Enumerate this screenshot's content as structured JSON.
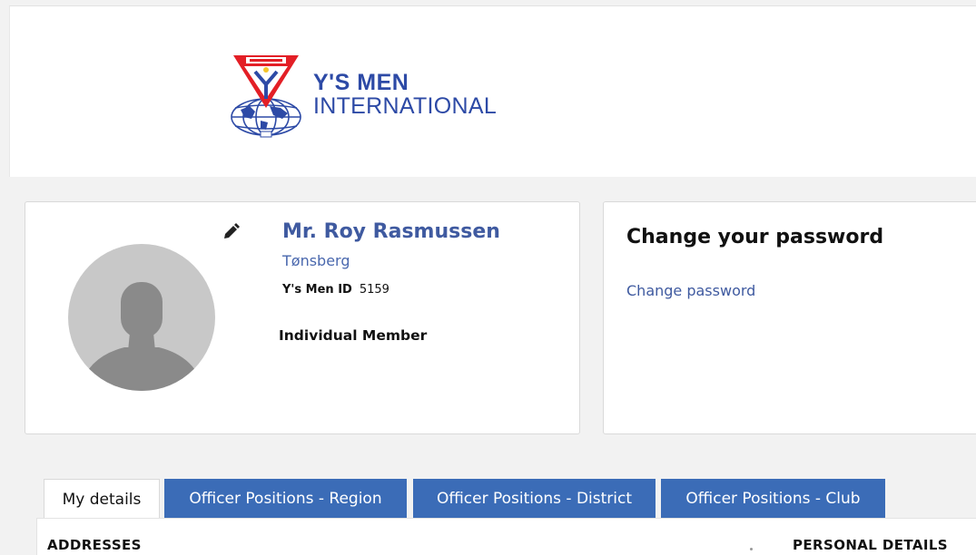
{
  "header": {
    "logo_line1": "Y'S MEN",
    "logo_line2": "INTERNATIONAL"
  },
  "profile": {
    "name": "Mr. Roy Rasmussen",
    "city": "Tønsberg",
    "id_label": "Y's Men ID",
    "id_value": "5159",
    "member_type": "Individual Member"
  },
  "password": {
    "title": "Change your password",
    "link": "Change password"
  },
  "tabs": [
    {
      "label": "My details",
      "active": true
    },
    {
      "label": "Officer Positions - Region",
      "active": false
    },
    {
      "label": "Officer Positions - District",
      "active": false
    },
    {
      "label": "Officer Positions - Club",
      "active": false
    }
  ],
  "sections": {
    "addresses": "ADDRESSES",
    "personal": "PERSONAL DETAILS"
  },
  "colors": {
    "brand_blue": "#2d4aa6",
    "tab_blue": "#3b6cb7",
    "logo_red": "#e31f26",
    "logo_yellow": "#f6c52b"
  }
}
